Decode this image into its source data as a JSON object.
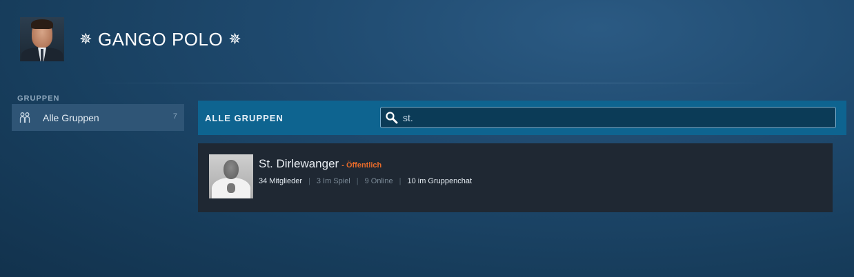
{
  "profile": {
    "name": "GANGO POLO",
    "decoration_left": "✵",
    "decoration_right": "✵",
    "avatar_icon": "profile-avatar"
  },
  "sidebar": {
    "heading": "GRUPPEN",
    "items": [
      {
        "label": "Alle Gruppen",
        "count": "7",
        "icon": "groups-icon"
      }
    ]
  },
  "main": {
    "heading": "ALLE GRUPPEN",
    "search": {
      "value": "st.",
      "placeholder": "",
      "icon": "search-icon"
    },
    "results": [
      {
        "name": "St. Dirlewanger",
        "visibility": "- Öffentlich",
        "members": "34 Mitglieder",
        "in_game": "3 Im Spiel",
        "online": "9 Online",
        "in_chat": "10 im Gruppenchat"
      }
    ]
  },
  "colors": {
    "accent_bar": "#0e6490",
    "visibility_orange": "#e86b2a",
    "card_bg": "#1f2833",
    "sidebar_active": "#2f5576"
  }
}
